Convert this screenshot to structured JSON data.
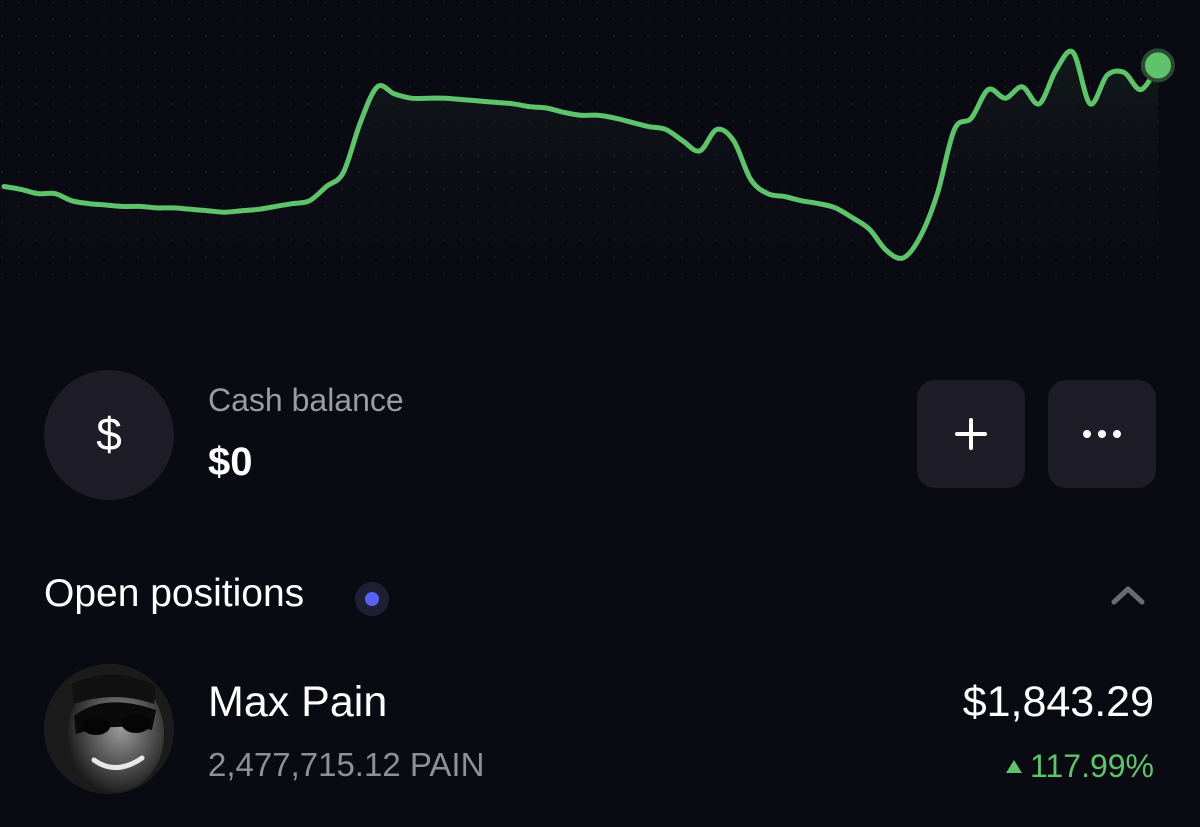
{
  "colors": {
    "background": "#0a0a13",
    "line": "#5ec36b",
    "accent_dot": "#5663f5",
    "muted_text": "#9b9ba6",
    "card": "#1d1c27"
  },
  "chart_data": {
    "type": "line",
    "title": "",
    "grid": "dotted",
    "series": [
      {
        "values": [
          200,
          198,
          195,
          195,
          190,
          188,
          187,
          186,
          186,
          185,
          185,
          184,
          183,
          182,
          183,
          184,
          186,
          188,
          190,
          200,
          210,
          245,
          270,
          265,
          262,
          262,
          262,
          261,
          260,
          259,
          258,
          256,
          255,
          252,
          250,
          250,
          248,
          245,
          242,
          240,
          232,
          225,
          240,
          232,
          205,
          195,
          193,
          190,
          188,
          185,
          178,
          170,
          155,
          150,
          165,
          195,
          240,
          248,
          268,
          262,
          270,
          258,
          282,
          294,
          258,
          278,
          280,
          268,
          285
        ]
      }
    ]
  },
  "cash": {
    "icon": "dollar-icon",
    "icon_glyph": "$",
    "label": "Cash balance",
    "value": "$0"
  },
  "actions": {
    "add_icon": "plus-icon",
    "more_icon": "more-icon"
  },
  "positions": {
    "title": "Open positions",
    "collapse_icon": "chevron-up-icon",
    "items": [
      {
        "name": "Max Pain",
        "amount": "2,477,715.12 PAIN",
        "value": "$1,843.29",
        "change": "117.99%",
        "direction": "up"
      }
    ]
  }
}
